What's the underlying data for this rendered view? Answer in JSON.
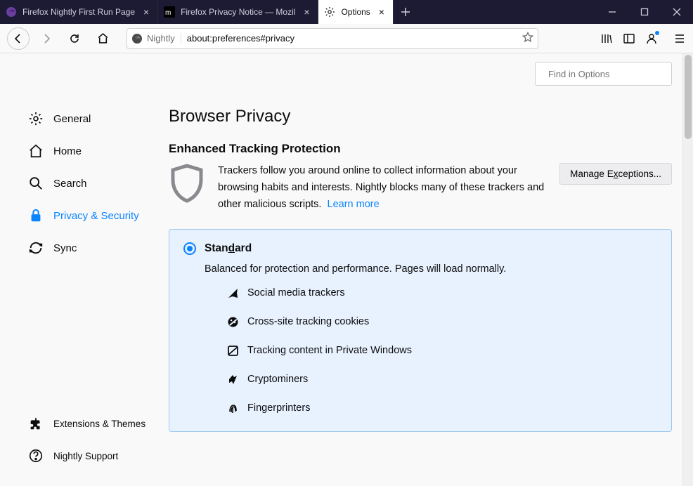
{
  "tabs": [
    {
      "label": "Firefox Nightly First Run Page"
    },
    {
      "label": "Firefox Privacy Notice — Mozil"
    },
    {
      "label": "Options"
    }
  ],
  "urlbar": {
    "identity": "Nightly",
    "url": "about:preferences#privacy"
  },
  "search": {
    "placeholder": "Find in Options"
  },
  "sidebar": {
    "items": [
      "General",
      "Home",
      "Search",
      "Privacy & Security",
      "Sync"
    ],
    "footer": [
      "Extensions & Themes",
      "Nightly Support"
    ]
  },
  "page": {
    "title": "Browser Privacy",
    "section_title": "Enhanced Tracking Protection",
    "desc": "Trackers follow you around online to collect information about your browsing habits and interests. Nightly blocks many of these trackers and other malicious scripts.",
    "learn_more": "Learn more",
    "manage_exceptions_pre": "Manage E",
    "manage_exceptions_u": "x",
    "manage_exceptions_post": "ceptions...",
    "standard": {
      "title_pre": "Stan",
      "title_u": "d",
      "title_post": "ard",
      "desc": "Balanced for protection and performance. Pages will load normally.",
      "trackers": [
        "Social media trackers",
        "Cross-site tracking cookies",
        "Tracking content in Private Windows",
        "Cryptominers",
        "Fingerprinters"
      ]
    }
  }
}
